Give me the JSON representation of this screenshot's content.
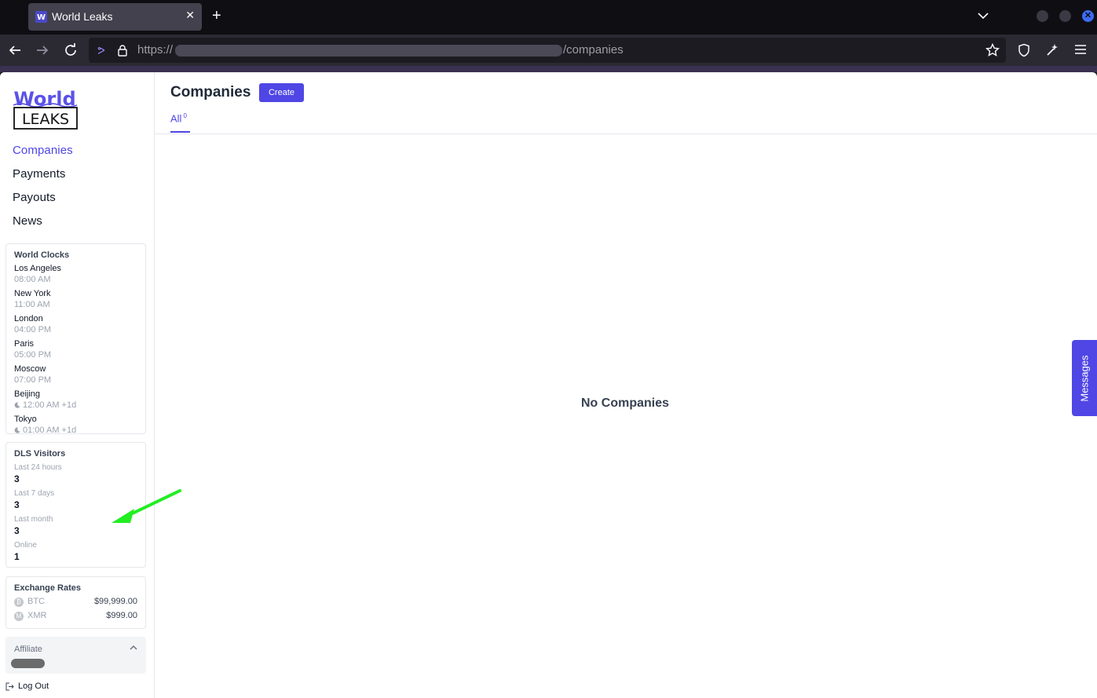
{
  "browser": {
    "tab_title": "World Leaks",
    "url_prefix": "https://",
    "url_suffix": "/companies"
  },
  "logo": {
    "line1": "World",
    "line2": "LEAKS"
  },
  "sidebar": {
    "nav": [
      {
        "label": "Companies",
        "active": true
      },
      {
        "label": "Payments"
      },
      {
        "label": "Payouts"
      },
      {
        "label": "News"
      }
    ],
    "world_clocks": {
      "title": "World Clocks",
      "clocks": [
        {
          "city": "Los Angeles",
          "time": "08:00 AM"
        },
        {
          "city": "New York",
          "time": "11:00 AM"
        },
        {
          "city": "London",
          "time": "04:00 PM"
        },
        {
          "city": "Paris",
          "time": "05:00 PM"
        },
        {
          "city": "Moscow",
          "time": "07:00 PM"
        },
        {
          "city": "Beijing",
          "time": "12:00 AM +1d"
        },
        {
          "city": "Tokyo",
          "time": "01:00 AM +1d"
        }
      ]
    },
    "visitors": {
      "title": "DLS Visitors",
      "stats": [
        {
          "label": "Last 24 hours",
          "value": "3"
        },
        {
          "label": "Last 7 days",
          "value": "3"
        },
        {
          "label": "Last month",
          "value": "3"
        },
        {
          "label": "Online",
          "value": "1"
        }
      ]
    },
    "exchange": {
      "title": "Exchange Rates",
      "rates": [
        {
          "coin": "BTC",
          "value": "$99,999.00"
        },
        {
          "coin": "XMR",
          "value": "$999.00"
        }
      ]
    },
    "affiliate_label": "Affiliate",
    "logout_label": "Log Out"
  },
  "main": {
    "title": "Companies",
    "create_label": "Create",
    "tab_all_label": "All",
    "tab_all_count": "0",
    "empty_message": "No Companies"
  },
  "messages_label": "Messages",
  "colors": {
    "accent": "#4f46e5",
    "annotation_arrow": "#22ee22"
  }
}
